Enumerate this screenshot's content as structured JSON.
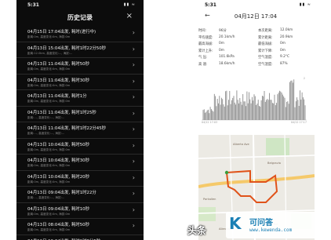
{
  "left": {
    "status_time": "5:31",
    "status_icons": "▮▮ ≈",
    "title": "历史记录",
    "close_icon": "×",
    "items": [
      {
        "main": "04月15日 17:04出发, 耗时(进行中)",
        "sub": "距离:0m, 高度变化:0m, 海拔:0m"
      },
      {
        "main": "04月13日 15:04出发, 耗时1时22分50秒",
        "sub": "距离:12.0km, 高度变化:..., 海拔:..."
      },
      {
        "main": "04月13日 11:04出发, 耗时50秒",
        "sub": "距离:0m, 高度变化:0m, 海拔:0m"
      },
      {
        "main": "04月13日 11:04出发, 耗时30秒",
        "sub": "距离:0m, 高度变化:0m, 海拔:0m"
      },
      {
        "main": "04月13日 11:04出发, 耗时1分",
        "sub": "距离:0m, 高度变化:0m, 海拔:0m"
      },
      {
        "main": "04月13日 11:04出发, 耗时1时25秒",
        "sub": "距离:..., 高度变化:..., 海拔:..."
      },
      {
        "main": "04月13日 11:04出发, 耗时1时22分45秒",
        "sub": "距离:..., 高度变化:..., 海拔:..."
      },
      {
        "main": "04月13日 10:04出发, 耗时50秒",
        "sub": "距离:0m, 高度变化:0m, 海拔:0m"
      },
      {
        "main": "04月13日 10:04出发, 耗时30秒",
        "sub": "距离:0m, 高度变化:0m, 海拔:0m"
      },
      {
        "main": "04月13日 10:04出发, 耗时20秒",
        "sub": "距离:0m, 高度变化:0m, 海拔:0m"
      },
      {
        "main": "04月13日 09:04出发, 耗时1时22分",
        "sub": "距离:..., 高度变化:..., 海拔:..."
      },
      {
        "main": "04月13日 09:04出发, 耗时10秒",
        "sub": "距离:0m, 高度变化:0m, 海拔:0m"
      },
      {
        "main": "04月13日 08:04出发, 耗时50秒",
        "sub": "距离:0m, 高度变化:0m, 海拔:0m"
      },
      {
        "main": "04月12日 19:04出发, 耗时1时8分5秒",
        "sub": "距离:..., 高度变化:..., 海拔:..."
      }
    ],
    "chevron": "›"
  },
  "right": {
    "status_time": "5:31",
    "status_icons": "▮▮ ≈",
    "back_icon": "←",
    "title": "04月12日 17:04",
    "stats": [
      {
        "k1": "时间:",
        "v1": "96分",
        "k2": "本次距离:",
        "v2": "12.0km"
      },
      {
        "k1": "平均速度:",
        "v1": "20.1km/h",
        "k2": "累计距离:",
        "v2": "20.9km"
      },
      {
        "k1": "最高海拔:",
        "v1": "0m",
        "k2": "最低海拔:",
        "v2": "0m"
      },
      {
        "k1": "累计上升:",
        "v1": "0m",
        "k2": "累计下降:",
        "v2": "0m"
      },
      {
        "k1": "气 压:",
        "v1": "101.6kPa",
        "k2": "空气温度:",
        "v2": "9.2°C"
      },
      {
        "k1": "高 速:",
        "v1": "18.6km/h",
        "k2": "空气湿度:",
        "v2": "87%"
      }
    ],
    "chart": {
      "x_start": "04/12 17:03",
      "x_end": "04/12 17:17",
      "y_top": "2"
    },
    "map_places": [
      "Alberta Ave",
      "Belgravia",
      "Parkallen",
      "Scona Rd",
      "Allendale"
    ]
  },
  "watermark": {
    "source": "头条",
    "logo_k": "K",
    "name": "可问答",
    "url": "www.kewenda.com"
  }
}
